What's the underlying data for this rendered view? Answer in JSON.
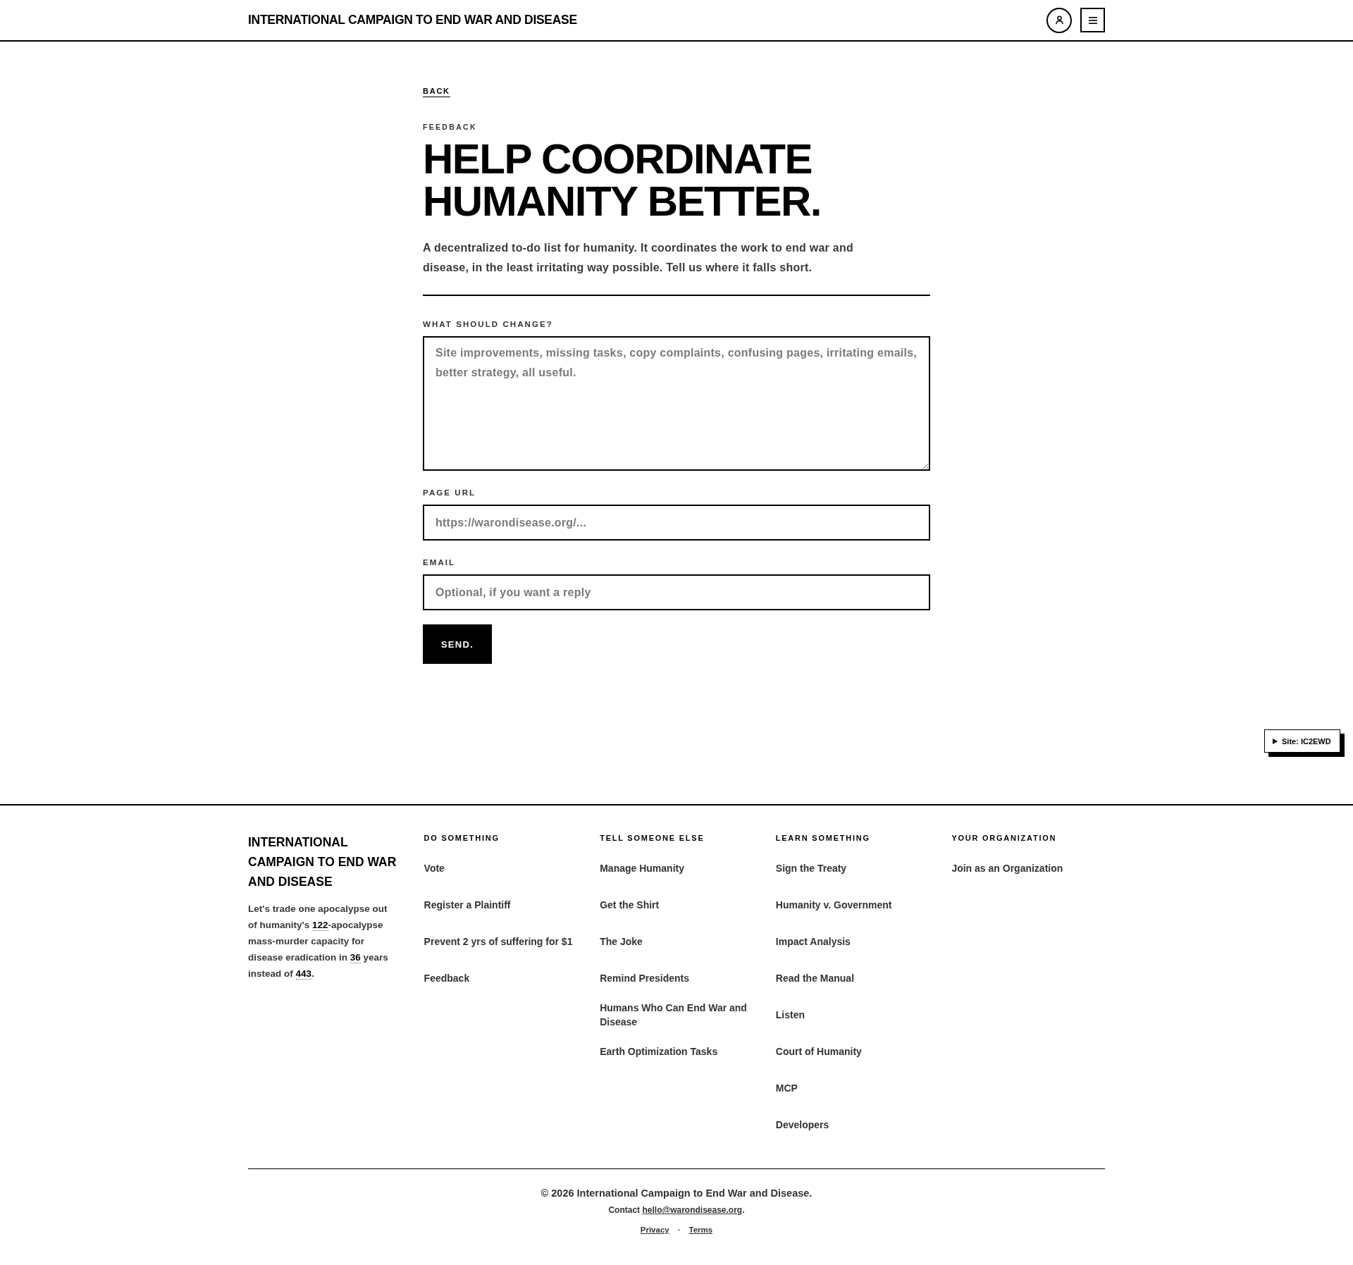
{
  "header": {
    "logo": "INTERNATIONAL CAMPAIGN TO END WAR AND DISEASE"
  },
  "back_link": "BACK",
  "eyebrow": "FEEDBACK",
  "heading": "HELP COORDINATE HUMANITY BETTER.",
  "intro": "A decentralized to-do list for humanity. It coordinates the work to end war and disease, in the least irritating way possible. Tell us where it falls short.",
  "form": {
    "fields": [
      {
        "kind": "textarea",
        "label": "WHAT SHOULD CHANGE?",
        "placeholder": "Site improvements, missing tasks, copy complaints, confusing pages, irritating emails, better strategy, all useful."
      },
      {
        "kind": "input",
        "label": "PAGE URL",
        "placeholder": "https://warondisease.org/..."
      },
      {
        "kind": "input",
        "label": "EMAIL",
        "placeholder": "Optional, if you want a reply"
      }
    ],
    "submit": "SEND."
  },
  "site_badge": {
    "label": "Site: IC2EWD",
    "expanded": false
  },
  "footer": {
    "brand": "INTERNATIONAL CAMPAIGN TO END WAR AND DISEASE",
    "tagline": "Let's trade one apocalypse out of humanity's **122**-apocalypse mass-murder capacity for disease eradication in **36** years instead of **443**.",
    "columns": [
      {
        "heading": "DO SOMETHING",
        "links": [
          "Vote",
          "Register a Plaintiff",
          "Prevent 2 yrs of suffering for $1",
          "Feedback"
        ]
      },
      {
        "heading": "TELL SOMEONE ELSE",
        "links": [
          "Manage Humanity",
          "Get the Shirt",
          "The Joke",
          "Remind Presidents",
          "Humans Who Can End War and Disease",
          "Earth Optimization Tasks"
        ]
      },
      {
        "heading": "LEARN SOMETHING",
        "links": [
          "Sign the Treaty",
          "Humanity v. Government",
          "Impact Analysis",
          "Read the Manual",
          "Listen",
          "Court of Humanity",
          "MCP",
          "Developers"
        ]
      },
      {
        "heading": "YOUR ORGANIZATION",
        "links": [
          "Join as an Organization"
        ]
      }
    ],
    "copyright": "© 2026 International Campaign to End War and Disease.",
    "contact": {
      "prefix": "Contact",
      "email": "hello@warondisease.org",
      "suffix": "."
    },
    "legal_links": [
      "Privacy",
      "Terms"
    ],
    "separator": "·"
  }
}
